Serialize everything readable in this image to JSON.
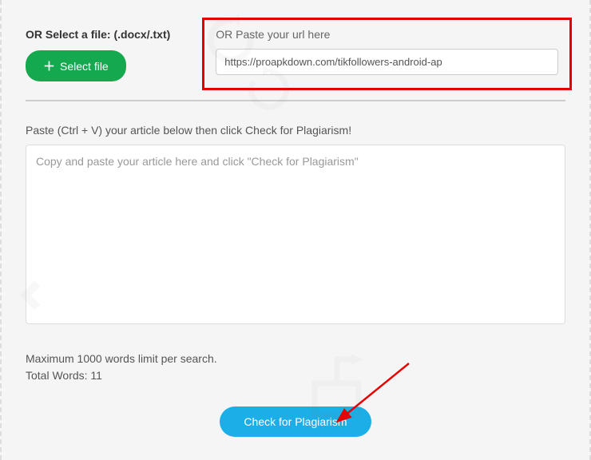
{
  "file_section": {
    "label": "OR Select a file: (.docx/.txt)",
    "button_label": "Select file"
  },
  "url_section": {
    "label": "OR Paste your url here",
    "input_value": "https://proapkdown.com/tikfollowers-android-ap"
  },
  "paste_section": {
    "label": "Paste (Ctrl + V) your article below then click Check for Plagiarism!",
    "placeholder": "Copy and paste your article here and click \"Check for Plagiarism\""
  },
  "stats": {
    "max_words_line": "Maximum 1000 words limit per search.",
    "total_words_line": "Total Words: 11"
  },
  "check_button_label": "Check for Plagiarism"
}
